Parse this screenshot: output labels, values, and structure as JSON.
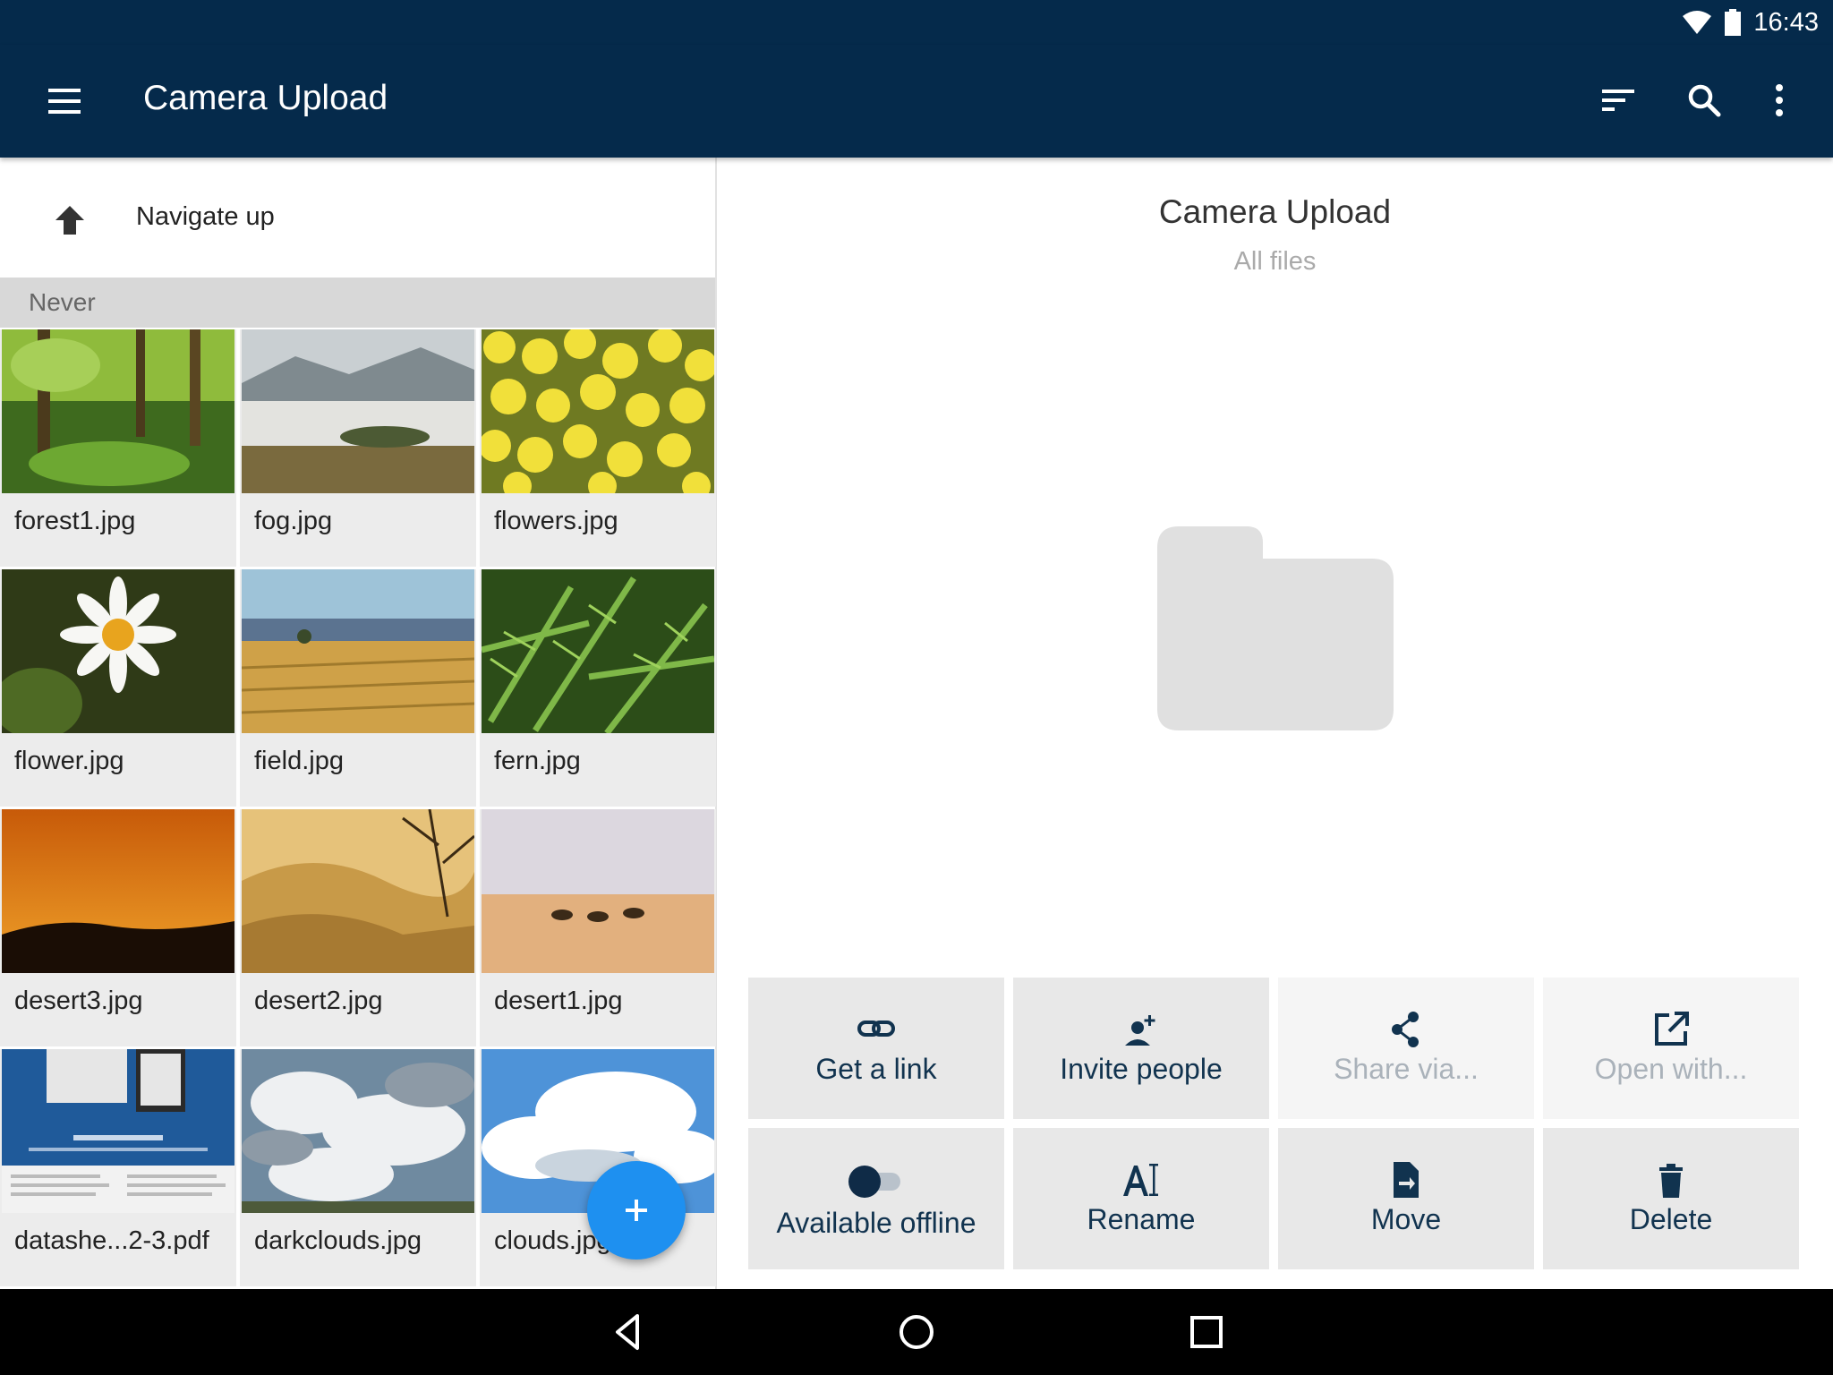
{
  "status_bar": {
    "time": "16:43"
  },
  "app_bar": {
    "title": "Camera Upload",
    "menu_icon": "menu-icon",
    "actions": [
      "sort-icon",
      "search-icon",
      "more-vert-icon"
    ]
  },
  "file_list": {
    "navigate_up_label": "Navigate up",
    "section_header": "Never",
    "files": [
      {
        "name": "forest1.jpg",
        "thumb": "forest"
      },
      {
        "name": "fog.jpg",
        "thumb": "fog"
      },
      {
        "name": "flowers.jpg",
        "thumb": "flowers"
      },
      {
        "name": "flower.jpg",
        "thumb": "daisy"
      },
      {
        "name": "field.jpg",
        "thumb": "field"
      },
      {
        "name": "fern.jpg",
        "thumb": "fern"
      },
      {
        "name": "desert3.jpg",
        "thumb": "sunset"
      },
      {
        "name": "desert2.jpg",
        "thumb": "dunes"
      },
      {
        "name": "desert1.jpg",
        "thumb": "camels"
      },
      {
        "name": "datashe...2-3.pdf",
        "thumb": "pdf"
      },
      {
        "name": "darkclouds.jpg",
        "thumb": "darkclouds"
      },
      {
        "name": "clouds.jpg",
        "thumb": "clouds"
      }
    ],
    "fab_icon": "plus-icon"
  },
  "details": {
    "title": "Camera Upload",
    "subtitle": "All files",
    "icon": "folder-icon"
  },
  "actions": [
    {
      "label": "Get a link",
      "icon": "link-icon",
      "enabled": true
    },
    {
      "label": "Invite people",
      "icon": "person-add-icon",
      "enabled": true
    },
    {
      "label": "Share via...",
      "icon": "share-icon",
      "enabled": false
    },
    {
      "label": "Open with...",
      "icon": "open-external-icon",
      "enabled": false
    },
    {
      "label": "Available offline",
      "icon": "toggle-icon",
      "enabled": true,
      "toggle_on": false
    },
    {
      "label": "Rename",
      "icon": "rename-icon",
      "enabled": true
    },
    {
      "label": "Move",
      "icon": "move-icon",
      "enabled": true
    },
    {
      "label": "Delete",
      "icon": "delete-icon",
      "enabled": true
    }
  ],
  "colors": {
    "primary": "#052a4b",
    "fab": "#1e90f0",
    "action_text": "#11334f",
    "disabled_text": "#aab2ba"
  }
}
